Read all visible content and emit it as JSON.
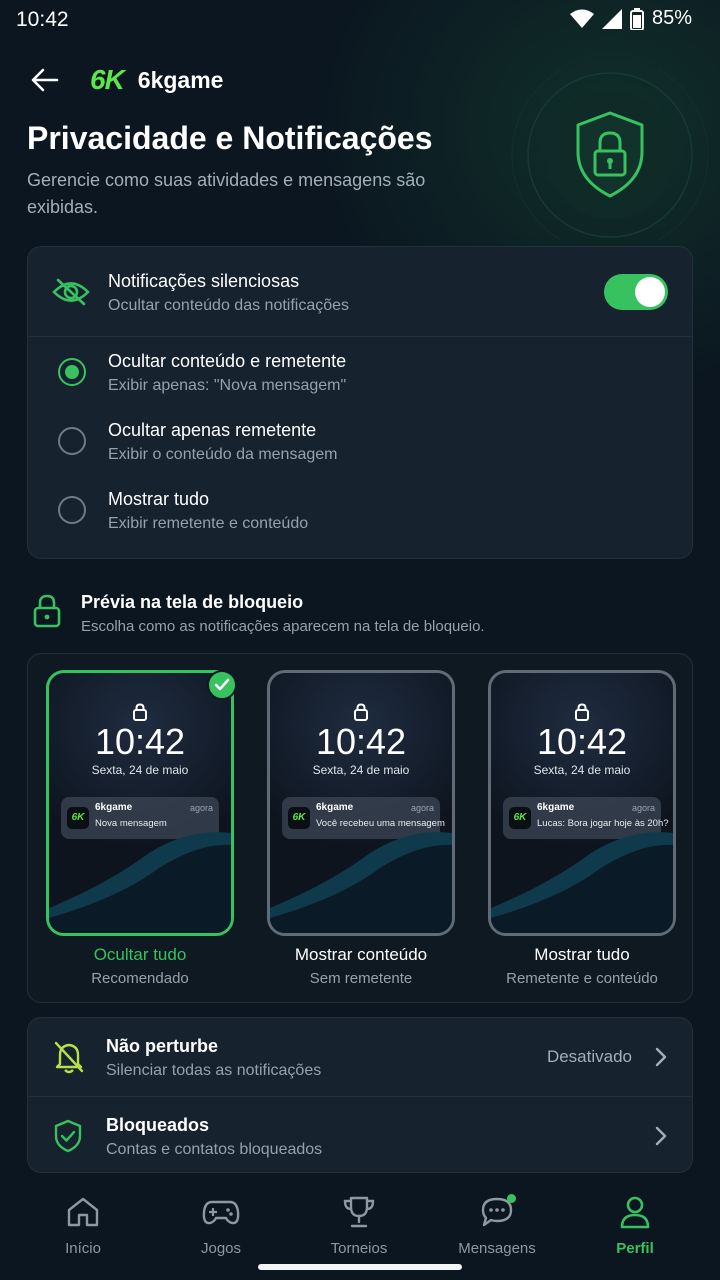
{
  "status_bar": {
    "time": "10:42",
    "battery": "85%"
  },
  "header": {
    "logo": "6K",
    "app_name": "6kgame"
  },
  "page": {
    "title": "Privacidade e Notificações",
    "subtitle": "Gerencie como suas atividades e mensagens são exibidas."
  },
  "silent_notifications": {
    "title": "Notificações silenciosas",
    "subtitle": "Ocultar conteúdo das notificações",
    "enabled": true,
    "options": [
      {
        "title": "Ocultar conteúdo e remetente",
        "subtitle": "Exibir apenas: \"Nova mensagem\"",
        "selected": true
      },
      {
        "title": "Ocultar apenas remetente",
        "subtitle": "Exibir o conteúdo da mensagem",
        "selected": false
      },
      {
        "title": "Mostrar tudo",
        "subtitle": "Exibir remetente e conteúdo",
        "selected": false
      }
    ]
  },
  "lockscreen": {
    "title": "Prévia na tela de bloqueio",
    "subtitle": "Escolha como as notificações aparecem na tela de bloqueio.",
    "previews": [
      {
        "time": "10:42",
        "date": "Sexta, 24 de maio",
        "app": "6kgame",
        "when": "agora",
        "logo": "6K",
        "message": "Nova mensagem",
        "label": "Ocultar tudo",
        "sublabel": "Recomendado",
        "selected": true
      },
      {
        "time": "10:42",
        "date": "Sexta, 24 de maio",
        "app": "6kgame",
        "when": "agora",
        "logo": "6K",
        "message": "Você recebeu uma mensagem",
        "label": "Mostrar conteúdo",
        "sublabel": "Sem remetente",
        "selected": false
      },
      {
        "time": "10:42",
        "date": "Sexta, 24 de maio",
        "app": "6kgame",
        "when": "agora",
        "logo": "6K",
        "message": "Lucas: Bora jogar hoje às 20h?",
        "label": "Mostrar tudo",
        "sublabel": "Remetente e conteúdo",
        "selected": false
      }
    ]
  },
  "more_settings": [
    {
      "title": "Não perturbe",
      "subtitle": "Silenciar todas as notificações",
      "value": "Desativado",
      "icon": "bell-off-icon"
    },
    {
      "title": "Bloqueados",
      "subtitle": "Contas e contatos bloqueados",
      "icon": "shield-check-icon"
    }
  ],
  "bottom_nav": [
    {
      "label": "Início",
      "icon": "home-icon"
    },
    {
      "label": "Jogos",
      "icon": "gamepad-icon"
    },
    {
      "label": "Torneios",
      "icon": "trophy-icon"
    },
    {
      "label": "Mensagens",
      "icon": "chat-icon",
      "has_dot": true
    },
    {
      "label": "Perfil",
      "icon": "user-icon",
      "active": true
    }
  ],
  "colors": {
    "accent": "#37c25f",
    "logo_green": "#5de54a",
    "background": "#0b1620",
    "card": "#16222d"
  }
}
